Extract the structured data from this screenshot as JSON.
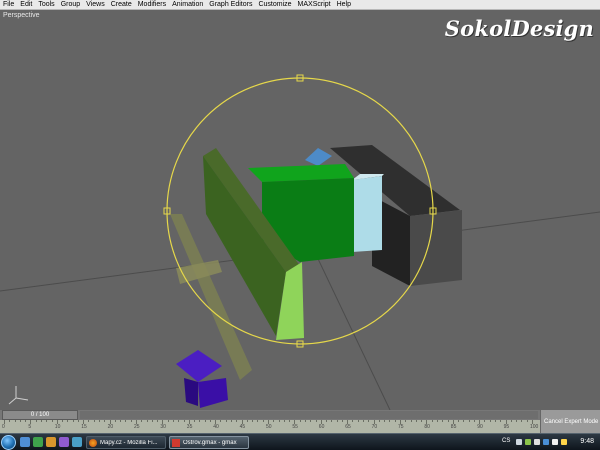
{
  "menu": [
    "File",
    "Edit",
    "Tools",
    "Group",
    "Views",
    "Create",
    "Modifiers",
    "Animation",
    "Graph Editors",
    "Customize",
    "MAXScript",
    "Help"
  ],
  "viewport": {
    "label": "Perspective",
    "brand": "SokolDesign"
  },
  "timeline": {
    "frame_display": "0 / 100",
    "ticks": [
      "0",
      "5",
      "10",
      "15",
      "20",
      "25",
      "30",
      "35",
      "40",
      "45",
      "50",
      "55",
      "60",
      "65",
      "70",
      "75",
      "80",
      "85",
      "90",
      "95",
      "100"
    ]
  },
  "status": {
    "expert_mode": "Cancel Expert Mode"
  },
  "taskbar": {
    "buttons": [
      {
        "label": "Mapy.cz - Mozilla Fi...",
        "icon": "firefox-icon"
      },
      {
        "label": "Ostrov.gmax - gmax",
        "icon": "gmax-icon"
      }
    ],
    "language": "CS",
    "clock": "9:48"
  },
  "colors": {
    "viewport_bg": "#646464",
    "selection_gizmo": "#e6d84a",
    "green_box": "#0a7d15",
    "light_green_wall": "#8fd45a",
    "dark_block": "#2e2e2e",
    "blue_house": "#3a0fa6",
    "light_blue": "#aedce8"
  }
}
